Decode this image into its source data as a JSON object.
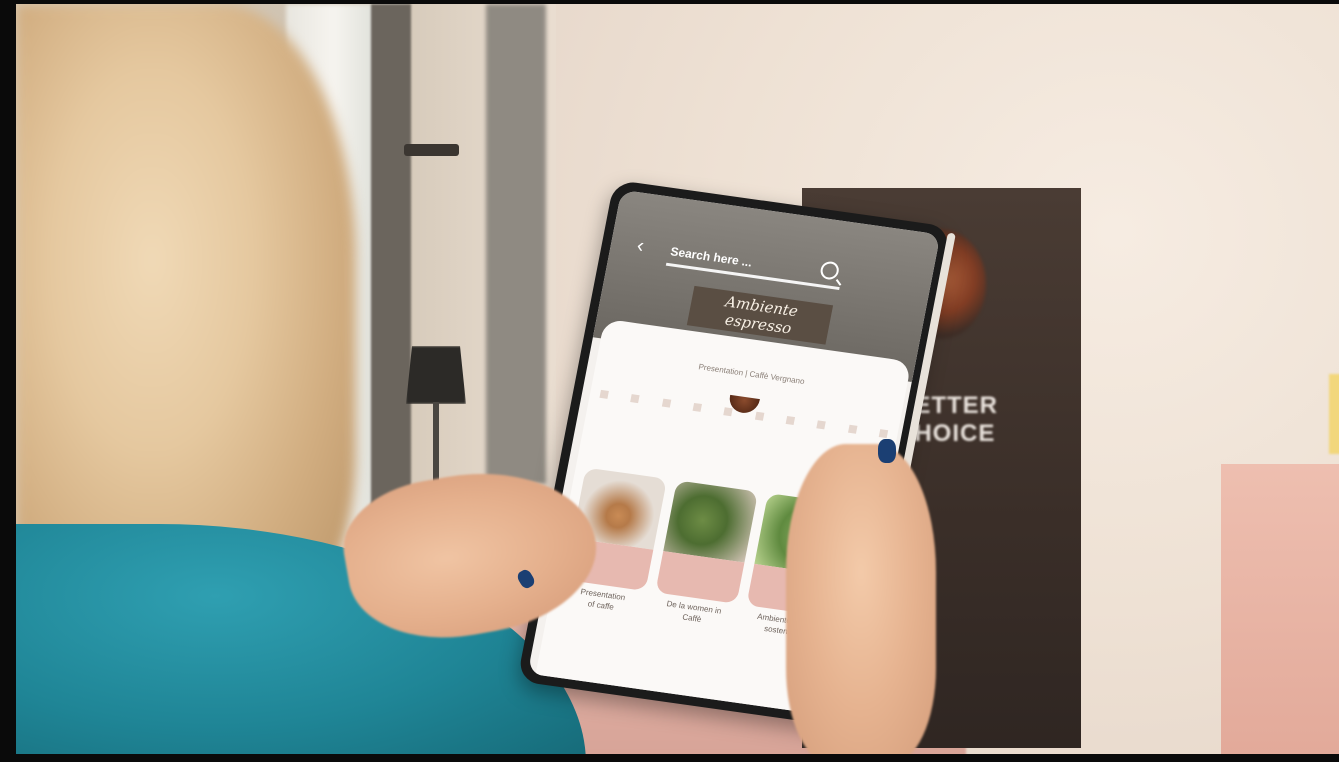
{
  "scene": {
    "description_free": true
  },
  "app": {
    "back_icon": "chevron-left-icon",
    "search": {
      "placeholder": "Search here ..."
    },
    "store_sign": "Ambiente espresso",
    "sheet_title": "Presentation | Caffè Vergnano",
    "cards": [
      {
        "caption": "Presentation\nof caffe"
      },
      {
        "caption": "De la women in\nCaffè"
      },
      {
        "caption": "Ambiente verde\nsostenibile"
      }
    ]
  },
  "poster": {
    "text": "BETTER\nCHOICE"
  },
  "colors": {
    "teal_shirt": "#1f8596",
    "nail_polish": "#1b3f73",
    "card_pink": "#e7b9b0"
  }
}
